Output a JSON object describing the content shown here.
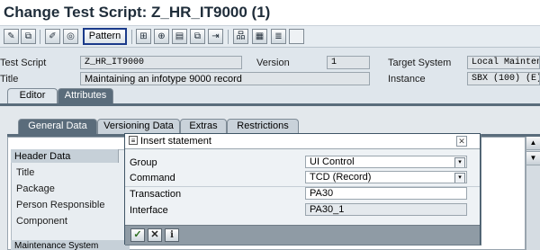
{
  "window": {
    "title": "Change Test Script: Z_HR_IT9000 (1)"
  },
  "toolbar": {
    "pattern_label": "Pattern",
    "icons": [
      "edit-pencil-icon",
      "display-change-icon",
      "check-syntax-icon",
      "activate-icon",
      "pattern-button",
      "insert-row-icon",
      "find-icon",
      "replace-icon",
      "copy-icon",
      "move-icon",
      "tree-icon",
      "layout-icon",
      "list-icon",
      "blank-icon"
    ]
  },
  "header": {
    "test_script_label": "Test Script",
    "test_script_value": "Z_HR_IT9000",
    "version_label": "Version",
    "version_value": "1",
    "target_system_label": "Target System",
    "target_system_value": "Local Mainten",
    "title_label": "Title",
    "title_value": "Maintaining an infotype 9000 record",
    "instance_label": "Instance",
    "instance_value": "SBX (100) (E)"
  },
  "top_tabs": [
    {
      "label": "Editor"
    },
    {
      "label": "Attributes"
    }
  ],
  "sub_tabs": [
    {
      "label": "General Data"
    },
    {
      "label": "Versioning Data"
    },
    {
      "label": "Extras"
    },
    {
      "label": "Restrictions"
    }
  ],
  "header_data": {
    "section_label": "Header Data",
    "rows": [
      "Title",
      "Package",
      "Person Responsible",
      "Component"
    ],
    "bottom_label": "Maintenance System"
  },
  "dialog": {
    "title": "Insert statement",
    "group_label": "Group",
    "group_value": "UI Control",
    "command_label": "Command",
    "command_value": "TCD (Record)",
    "transaction_label": "Transaction",
    "transaction_value": "PA30",
    "interface_label": "Interface",
    "interface_value": "PA30_1"
  }
}
